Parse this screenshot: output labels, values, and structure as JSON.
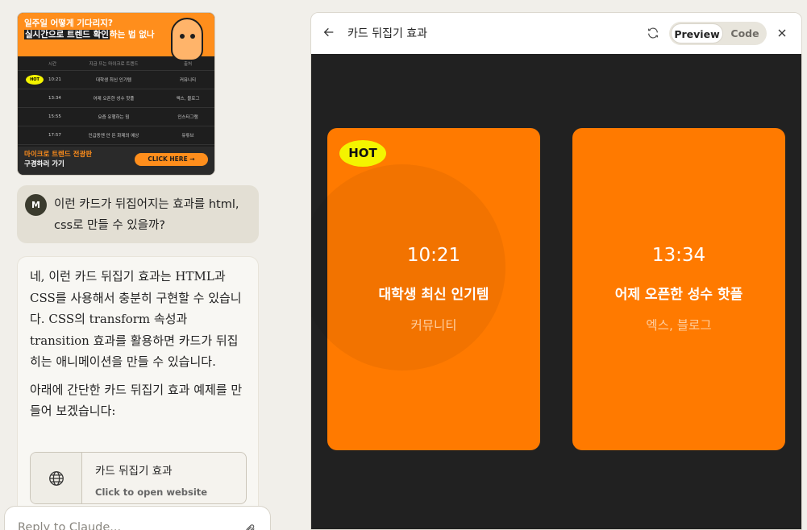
{
  "thumbnail": {
    "headline_line1": "일주일 어떻게 기다리지?",
    "headline_line2_highlight": "실시간으로 트렌드 확인",
    "headline_line2_rest": "하는 법 없나",
    "table_headers": [
      "시간",
      "지금 뜨는 마이크로 트렌드",
      "출처"
    ],
    "rows": [
      {
        "hot": "HOT",
        "time": "10:21",
        "topic": "대학생 최신 인기템",
        "source": "커뮤니티"
      },
      {
        "hot": "",
        "time": "13:34",
        "topic": "어제 오픈한 성수 핫플",
        "source": "엑스, 블로그"
      },
      {
        "hot": "",
        "time": "15:55",
        "topic": "요즘 유행하는 밈",
        "source": "인스타그램"
      },
      {
        "hot": "",
        "time": "17:57",
        "topic": "인급동엔 안 뜬 화제의 예상",
        "source": "유튜브"
      }
    ],
    "footer_line1": "마이크로 트렌드 전광판",
    "footer_line2": "구경하러 가기",
    "cta": "CLICK HERE →"
  },
  "chat": {
    "user_avatar": "M",
    "user_message": "이런 카드가 뒤집어지는 효과를 html, css로 만들 수 있을까?",
    "assistant_p1": "네, 이런 카드 뒤집기 효과는 HTML과 CSS를 사용해서 충분히 구현할 수 있습니다. CSS의 transform 속성과 transition 효과를 활용하면 카드가 뒤집히는 애니메이션을 만들 수 있습니다.",
    "assistant_p2": "아래에 간단한 카드 뒤집기 효과 예제를 만들어 보겠습니다:",
    "artifact_title": "카드 뒤집기 효과",
    "artifact_subtitle": "Click to open website",
    "reply_placeholder": "Reply to Claude..."
  },
  "panel": {
    "title": "카드 뒤집기 효과",
    "preview_label": "Preview",
    "code_label": "Code",
    "active_tab": "Preview"
  },
  "cards": [
    {
      "badge": "HOT",
      "time": "10:21",
      "title": "대학생 최신 인기템",
      "source": "커뮤니티"
    },
    {
      "badge": "",
      "time": "13:34",
      "title": "어제 오픈한 성수 핫플",
      "source": "엑스, 블로그"
    }
  ],
  "colors": {
    "card_orange": "#ff7a00",
    "badge_yellow": "#f4f400",
    "preview_bg": "#212121",
    "page_bg": "#f1efea"
  },
  "icons": [
    "back-arrow-icon",
    "refresh-icon",
    "close-icon",
    "globe-icon",
    "paperclip-icon"
  ]
}
